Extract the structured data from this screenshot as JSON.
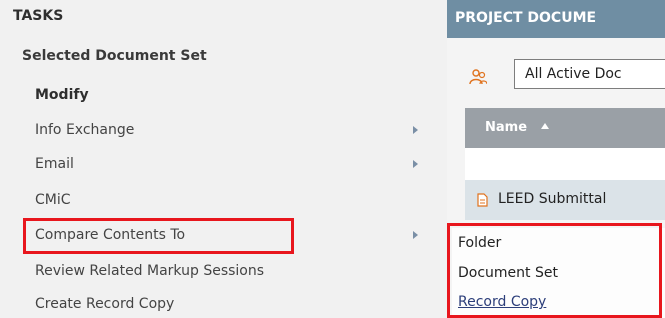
{
  "tasks": {
    "title": "TASKS",
    "section_heading": "Selected Document Set",
    "items": [
      {
        "label": "Modify",
        "bold": true,
        "has_submenu": false
      },
      {
        "label": "Info Exchange",
        "bold": false,
        "has_submenu": true
      },
      {
        "label": "Email",
        "bold": false,
        "has_submenu": true
      },
      {
        "label": "CMiC",
        "bold": false,
        "has_submenu": false
      },
      {
        "label": "Compare Contents To",
        "bold": false,
        "has_submenu": true,
        "highlighted": true
      },
      {
        "label": "Review Related Markup Sessions",
        "bold": false,
        "has_submenu": false
      },
      {
        "label": "Create Record Copy",
        "bold": false,
        "has_submenu": false
      }
    ]
  },
  "documents": {
    "title": "PROJECT DOCUME",
    "filter_value": "All Active Doc",
    "column_name": "Name",
    "row_label": "LEED Submittal"
  },
  "compare_submenu": {
    "items": [
      {
        "label": "Folder",
        "link": false
      },
      {
        "label": "Document Set",
        "link": false
      },
      {
        "label": "Record Copy",
        "link": true
      }
    ]
  },
  "colors": {
    "highlight": "#e8161d",
    "header_bg": "#6f8ea3",
    "grid_header_bg": "#9aa0a6",
    "row_bg": "#dbe3e8",
    "submenu_arrow": "#7a8fa6"
  }
}
